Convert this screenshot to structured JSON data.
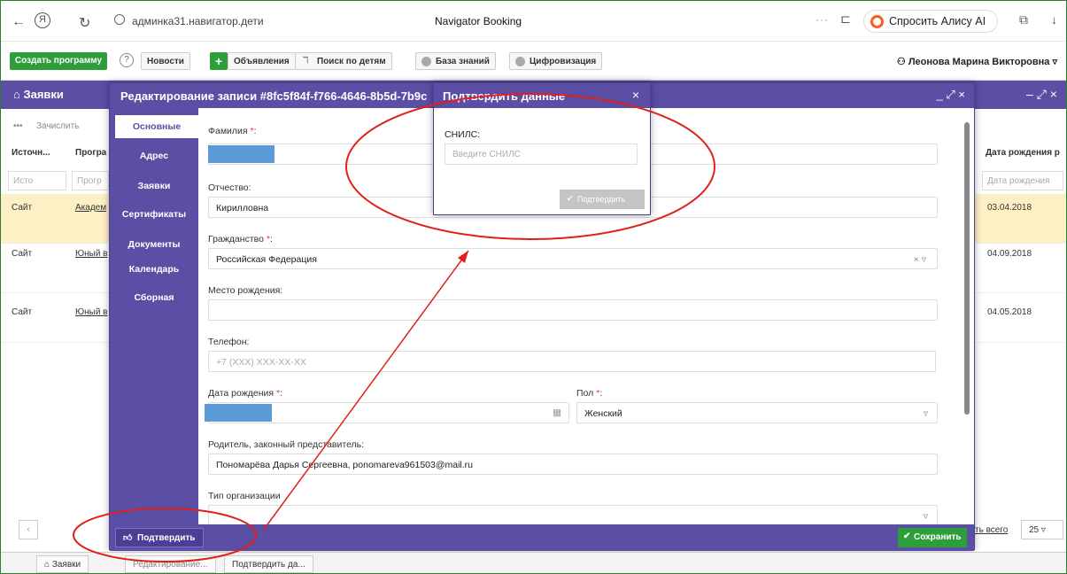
{
  "browser": {
    "host": "админка31.навигатор.дети",
    "tab_title": "Navigator Booking",
    "more": "···",
    "alice_label": "Спросить Алису AI"
  },
  "toolbar": {
    "create_program": "Создать программу",
    "news": "Новости",
    "ads": "Объявления",
    "children_search": "Поиск по детям",
    "knowledge_base": "База знаний",
    "digitalization": "Цифровизация",
    "user": "Леонова Марина Викторовна"
  },
  "background_window": {
    "title": "Заявки",
    "enroll": "Зачислить",
    "columns": [
      "Источн...",
      "Програ",
      "Дата рождения р"
    ],
    "filters": [
      "Исто",
      "Прогр",
      "Дата рождения"
    ],
    "rows": [
      {
        "source": "Сайт",
        "program": "Академ",
        "birth": "03.04.2018"
      },
      {
        "source": "Сайт",
        "program": "Юный в",
        "birth": "04.09.2018"
      },
      {
        "source": "Сайт",
        "program": "Юный в",
        "birth": "04.05.2018"
      }
    ],
    "total": "ть всего",
    "page_size": "25"
  },
  "modal": {
    "title": "Редактирование записи #8fc5f84f-f766-4646-8b5d-7b9c",
    "tabs": [
      "Основные",
      "Адрес",
      "Заявки",
      "Сертификаты",
      "Документы",
      "Календарь",
      "Сборная"
    ],
    "fields": {
      "surname_label": "Фамилия",
      "patronymic_label": "Отчество:",
      "patronymic_value": "Кирилловна",
      "citizenship_label": "Гражданство",
      "citizenship_value": "Российская Федерация",
      "birthplace_label": "Место рождения:",
      "phone_label": "Телефон:",
      "phone_placeholder": "+7 (XXX) XXX-XX-XX",
      "birthdate_label": "Дата рождения",
      "gender_label": "Пол",
      "gender_value": "Женский",
      "parent_label": "Родитель, законный представитель:",
      "parent_value": "Пономарёва Дарья Сергеевна, ponomareva961503@mail.ru",
      "org_type_label": "Тип организации"
    },
    "confirm_button": "Подтвердить",
    "save_button": "Сохранить"
  },
  "dialog": {
    "title": "Подтвердить данные",
    "snils_label": "СНИЛС:",
    "snils_placeholder": "Введите СНИЛС",
    "confirm_button": "Подтвердить"
  },
  "taskbar": [
    "Заявки",
    "Редактирование...",
    "Подтвердить да..."
  ],
  "colors": {
    "purple": "#5a4ea5",
    "green": "#2e9e3b",
    "annotation": "#e0201b"
  }
}
